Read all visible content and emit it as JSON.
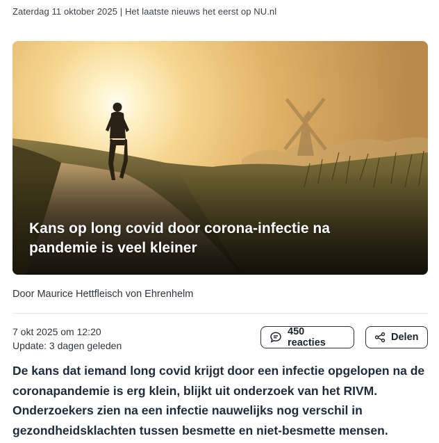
{
  "header": {
    "topline": "Zaterdag 11 oktober 2025 | Het laatste nieuws het eerst op NU.nl"
  },
  "article": {
    "title": "Kans op long covid door corona-infectie na pandemie is veel kleiner",
    "byline": "Door Maurice Hettfleisch von Ehrenhelm",
    "published": "7 okt 2025 om 12:20",
    "updated": "Update: 3 dagen geleden",
    "lead": "De kans dat iemand long covid krijgt door een infectie opgelopen na de coronapandemie is erg klein, blijkt uit onderzoek van het RIVM. Onderzoekers zien na een infectie nauwelijks nog verschil in gezondheidsklachten tussen besmette en niet-besmette mensen."
  },
  "actions": {
    "reactions_label": "450 reacties",
    "share_label": "Delen"
  },
  "icons": {
    "reactions": "speech-bubble-icon",
    "share": "share-icon"
  },
  "colors": {
    "text": "#20242b",
    "lead_text": "#1f2a3a",
    "divider": "#e3e5e8"
  }
}
